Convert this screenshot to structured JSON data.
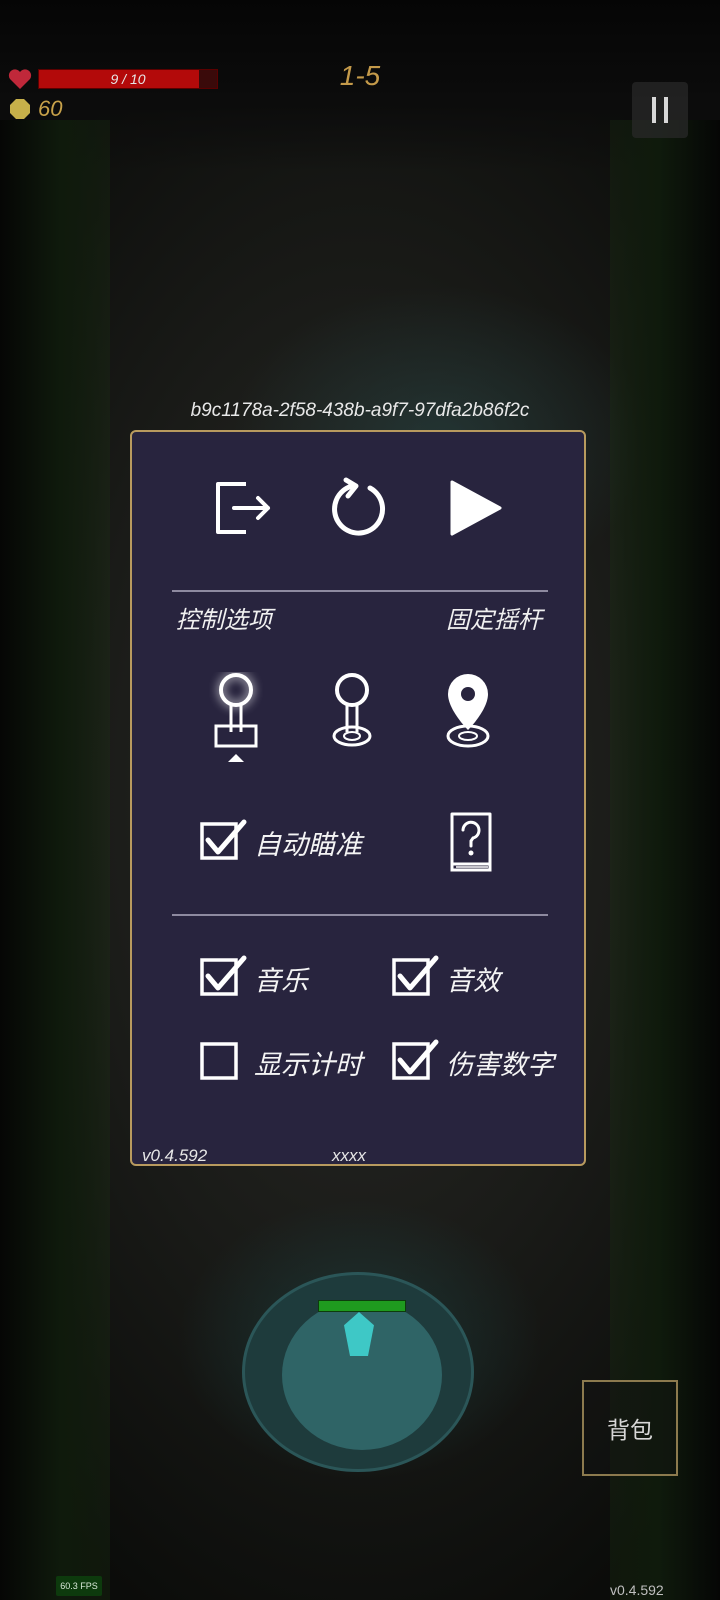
{
  "hud": {
    "hp_text": "9 / 10",
    "hp_fraction": 0.9,
    "gold": "60",
    "level": "1-5",
    "pause_icon": "pause-icon"
  },
  "dialog": {
    "seed": "b9c1178a-2f58-438b-a9f7-97dfa2b86f2c",
    "top_icons": [
      "exit-icon",
      "restart-icon",
      "play-icon"
    ],
    "control_label": "控制选项",
    "joystick_label": "固定摇杆",
    "joystick_icons": [
      "fixed-joystick-icon",
      "floating-joystick-icon",
      "position-pin-icon"
    ],
    "auto_aim": {
      "label": "自动瞄准",
      "checked": true
    },
    "help_icon": "help-book-icon",
    "options": [
      {
        "label": "音乐",
        "checked": true
      },
      {
        "label": "音效",
        "checked": true
      },
      {
        "label": "显示计时",
        "checked": false
      },
      {
        "label": "伤害数字",
        "checked": true
      }
    ],
    "version": "v0.4.592",
    "footer_text": "xxxx"
  },
  "player": {
    "hp_fraction": 1.0
  },
  "bag_label": "背包",
  "fps": "60.3 FPS",
  "corner_version": "v0.4.592",
  "colors": {
    "panel_bg": "#28243e",
    "panel_border": "#b89a5e",
    "hp_red": "#b30a0a",
    "gold": "#c49a4a",
    "player_cyan": "#3ec8c6"
  }
}
